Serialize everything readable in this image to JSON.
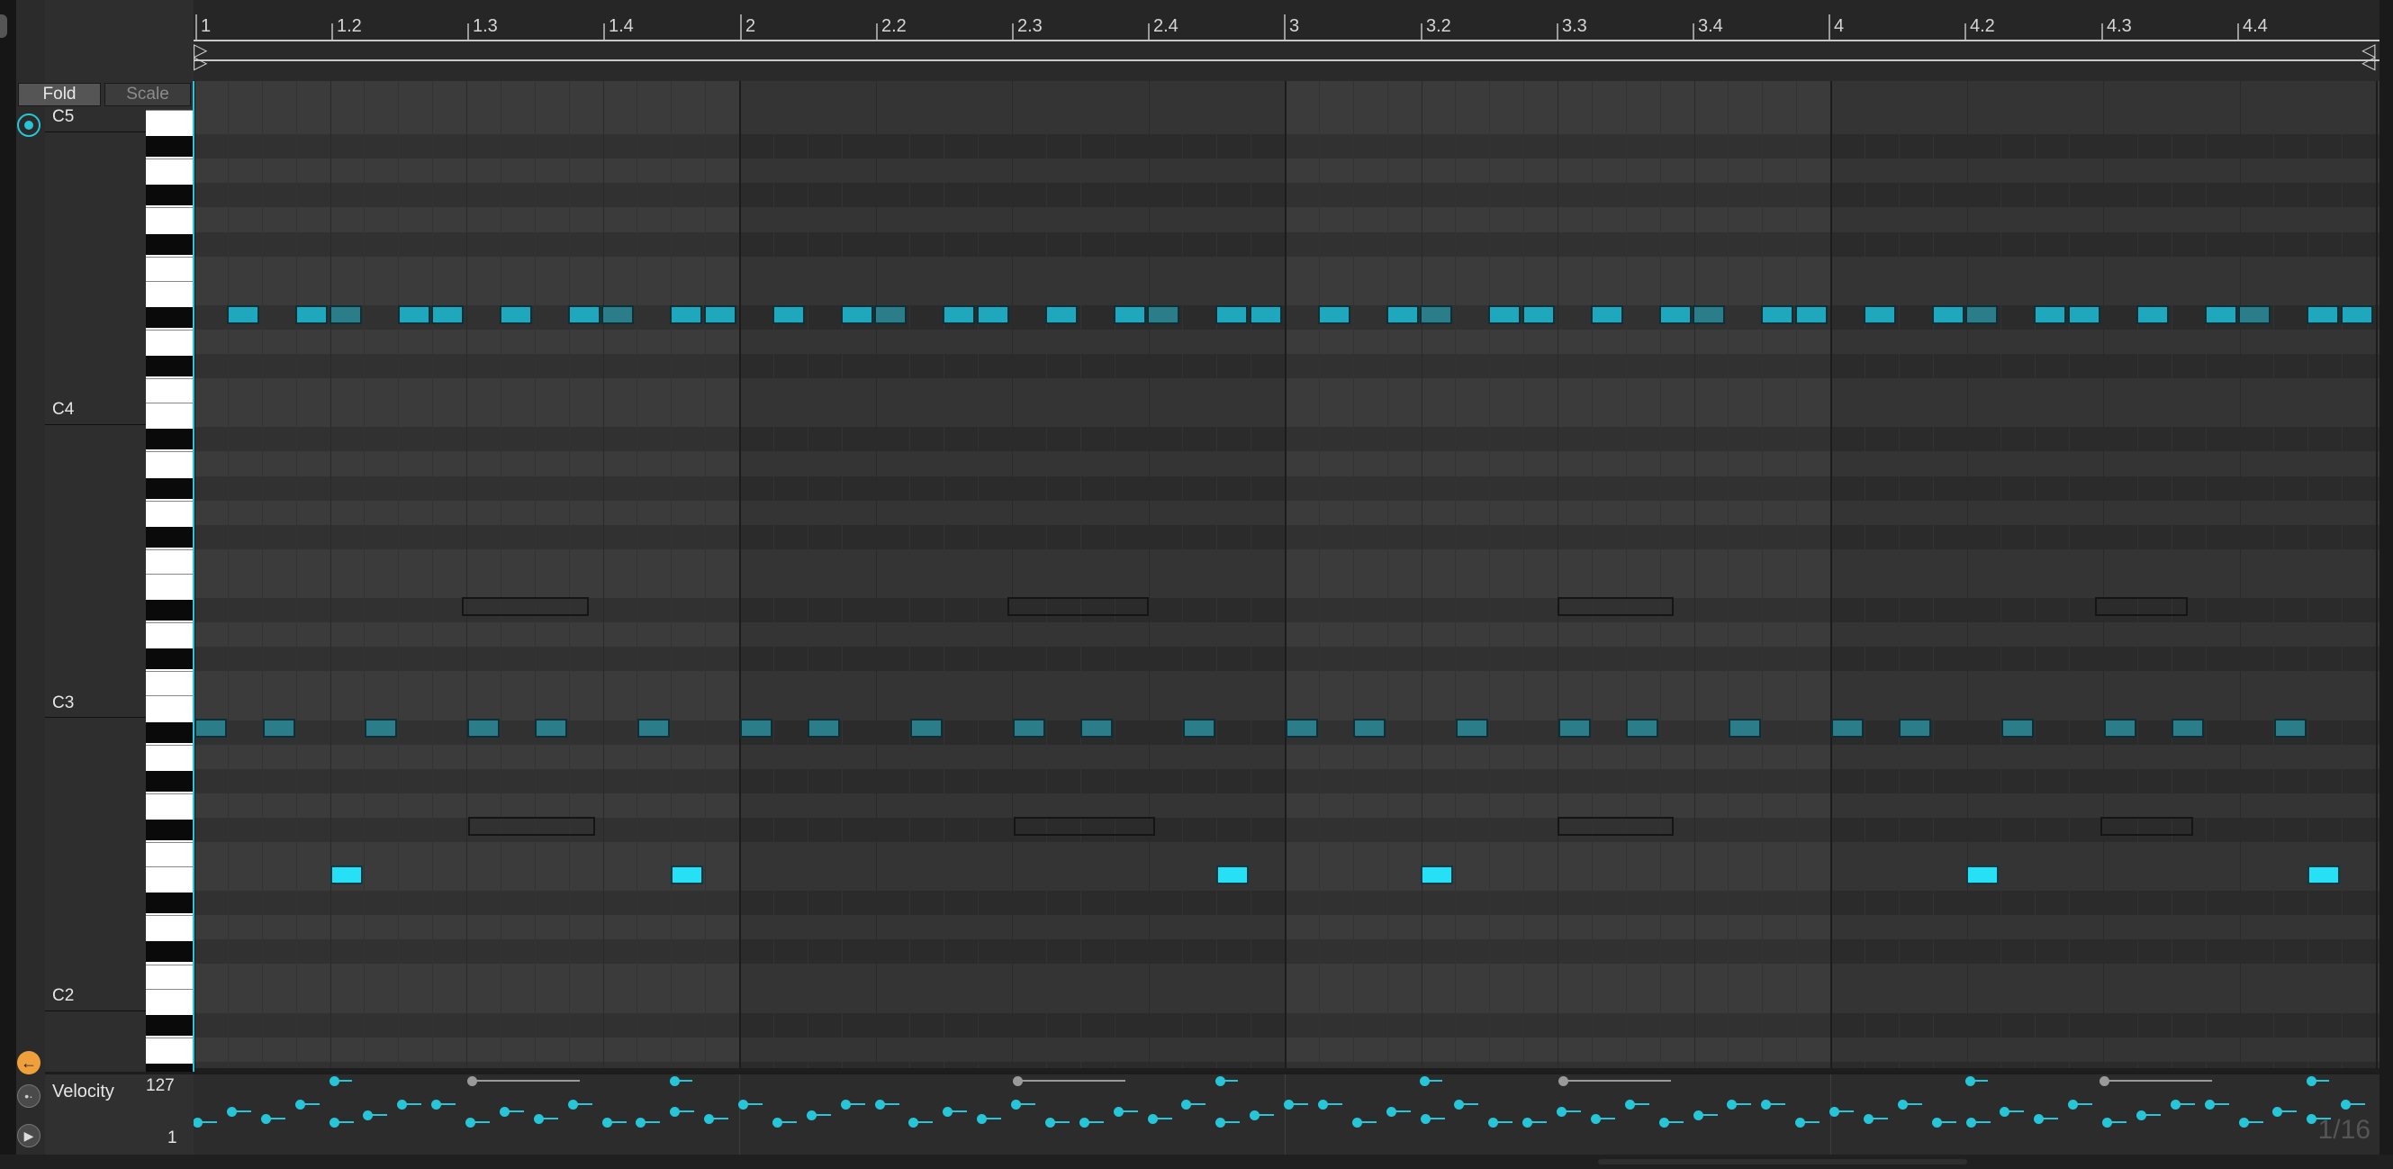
{
  "toolbar": {
    "fold_label": "Fold",
    "scale_label": "Scale"
  },
  "ruler": {
    "labels": [
      "1",
      "1.2",
      "1.3",
      "1.4",
      "2",
      "2.2",
      "2.3",
      "2.4",
      "3",
      "3.2",
      "3.3",
      "3.4",
      "4",
      "4.2",
      "4.3",
      "4.4"
    ]
  },
  "piano": {
    "octave_labels": [
      "C5",
      "C4",
      "C3",
      "C2"
    ]
  },
  "velocity": {
    "label": "Velocity",
    "max": "127",
    "min": "1"
  },
  "grid": {
    "quantization": "1/16"
  },
  "colors": {
    "accent": "#27c5d8",
    "note_mid": "#1fa8bd",
    "note_dim": "#2c7d8a",
    "note_bright": "#26e0f5",
    "back_button": "#f0a03a"
  },
  "icons": {
    "preview": "headphone-icon",
    "back": "arrow-left-icon",
    "envelope": "envelope-icon",
    "play": "play-icon"
  }
}
